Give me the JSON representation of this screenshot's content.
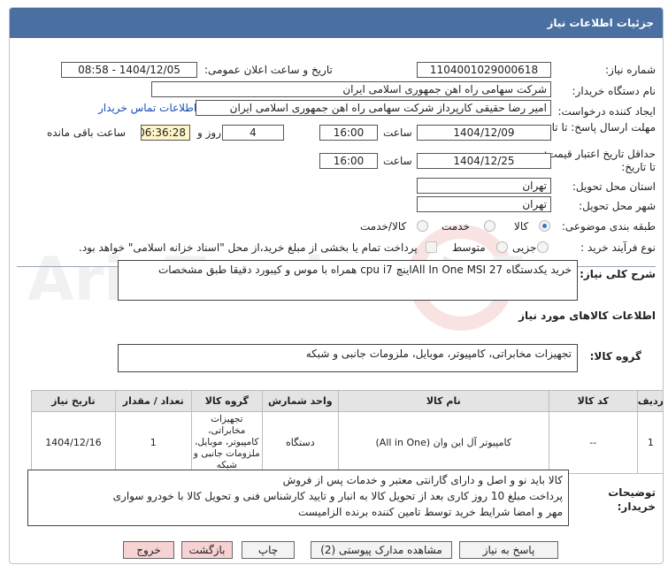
{
  "header": {
    "title": "جزئیات اطلاعات نیاز"
  },
  "fields": {
    "need_number_label": "شماره نیاز:",
    "need_number": "1104001029000618",
    "announce_label": "تاریخ و ساعت اعلان عمومی:",
    "announce_value": "1404/12/05 - 08:58",
    "buyer_label": "نام دستگاه خریدار:",
    "buyer_value": "شرکت سهامی راه اهن جمهوری اسلامی ایران",
    "creator_label": "ایجاد کننده درخواست:",
    "creator_value": "امیر رضا  حقیقی کارپرداز شرکت سهامی راه اهن جمهوری اسلامی ایران",
    "contact_link": "اطلاعات تماس خریدار",
    "reply_label": "مهلت ارسال پاسخ: تا تاریخ:",
    "reply_date": "1404/12/09",
    "time_label": "ساعت",
    "reply_time": "16:00",
    "days_value": "4",
    "days_label": "روز و",
    "remaining_time": "06:36:28",
    "remaining_label": "ساعت باقی مانده",
    "validity_label": "حداقل تاریخ اعتبار قیمت: تا تاریخ:",
    "validity_date": "1404/12/25",
    "validity_time": "16:00",
    "province_label": "استان محل تحویل:",
    "province_value": "تهران",
    "city_label": "شهر محل تحویل:",
    "city_value": "تهران",
    "category_label": "طبقه بندی موضوعی:",
    "category_options": [
      "کالا",
      "خدمت",
      "کالا/خدمت"
    ],
    "process_label": "نوع فرآیند خرید :",
    "process_options": [
      "جزیی",
      "متوسط"
    ],
    "payment_note": "پرداخت تمام یا بخشی از مبلغ خرید،از محل \"اسناد خزانه اسلامی\" خواهد بود."
  },
  "description": {
    "label": "شرح کلی نیاز:",
    "value": "خرید یکدستگاه All In One MSI  27اینچ cpu i7 همراه با موس و کیبورد دقیقا طبق مشخصات"
  },
  "goods_info": {
    "title": "اطلاعات کالاهای مورد نیاز",
    "group_label": "گروه کالا:",
    "group_value": "تجهیزات مخابراتی، کامپیوتر، موبایل، ملزومات جانبی و شبکه"
  },
  "table": {
    "headers": [
      "ردیف",
      "کد کالا",
      "نام کالا",
      "واحد شمارش",
      "گروه کالا",
      "تعداد / مقدار",
      "تاریخ نیاز"
    ],
    "rows": [
      [
        "1",
        "--",
        "کامپیوتر آل این وان (All in One)",
        "دستگاه",
        "تجهیزات مخابراتی، کامپیوتر، موبایل، ملزومات جانبی و شبکه",
        "1",
        "1404/12/16"
      ]
    ]
  },
  "notes": {
    "label": "توضیحات خریدار:",
    "lines": [
      "کالا باید نو و اصل و دارای گارانتی معتبر و خدمات پس از فروش",
      "پرداخت مبلغ 10 روز کاری  بعد از تحویل کالا به انبار و تایید کارشناس فنی و تحویل کالا با خودرو سواری",
      "مهر و امضا شرایط خرید توسط تامین کننده برنده الزامیست"
    ]
  },
  "buttons": {
    "reply": "پاسخ به نیاز",
    "attachments": "مشاهده مدارک پیوستی (2)",
    "print": "چاپ",
    "back": "بازگشت",
    "exit": "خروج"
  },
  "watermark": {
    "text": "AriaTender.neT"
  }
}
